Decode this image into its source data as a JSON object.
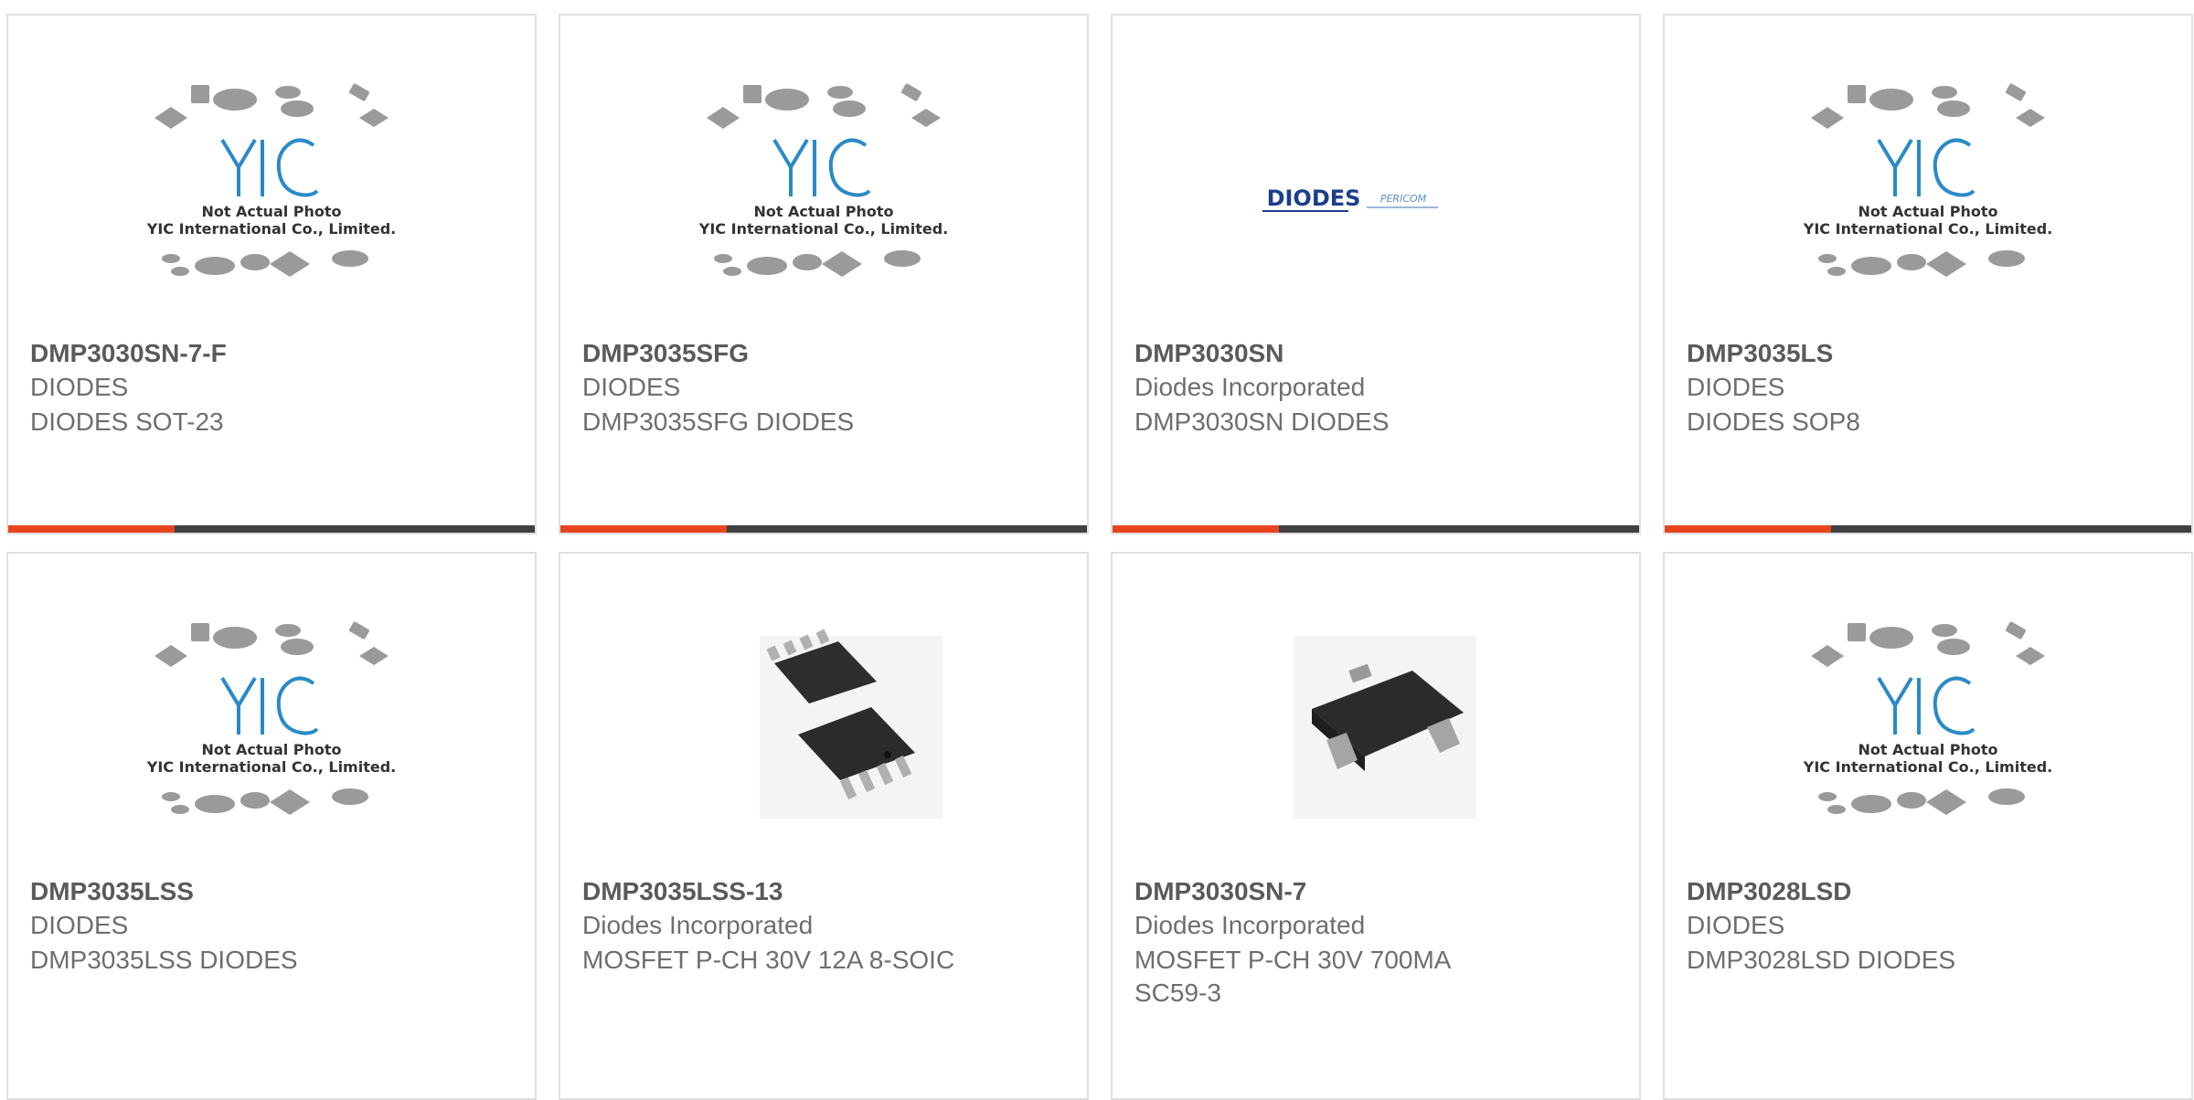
{
  "colors": {
    "accent": "#e8451f",
    "bar": "#404040",
    "title": "#5a5a5a",
    "text": "#6e6e6e",
    "yic_blue": "#2a8ac8"
  },
  "placeholder": {
    "line1": "Not Actual Photo",
    "line2": "YIC International Co., Limited.",
    "logo": "YIC"
  },
  "diodes_logo": {
    "brand": "DIODES",
    "sub": "PERICOM"
  },
  "products": [
    {
      "part": "DMP3030SN-7-F",
      "maker": "DIODES",
      "desc": "DIODES SOT-23",
      "image": "yic-placeholder"
    },
    {
      "part": "DMP3035SFG",
      "maker": "DIODES",
      "desc": "DMP3035SFG DIODES",
      "image": "yic-placeholder"
    },
    {
      "part": "DMP3030SN",
      "maker": "Diodes Incorporated",
      "desc": "DMP3030SN DIODES",
      "image": "diodes-logo"
    },
    {
      "part": "DMP3035LS",
      "maker": "DIODES",
      "desc": "DIODES SOP8",
      "image": "yic-placeholder"
    },
    {
      "part": "DMP3035LSS",
      "maker": "DIODES",
      "desc": "DMP3035LSS DIODES",
      "image": "yic-placeholder"
    },
    {
      "part": "DMP3035LSS-13",
      "maker": "Diodes Incorporated",
      "desc": "MOSFET P-CH 30V 12A 8-SOIC",
      "image": "soic8-chip"
    },
    {
      "part": "DMP3030SN-7",
      "maker": "Diodes Incorporated",
      "desc": "MOSFET P-CH 30V 700MA SC59-3",
      "image": "sot23-chip"
    },
    {
      "part": "DMP3028LSD",
      "maker": "DIODES",
      "desc": "DMP3028LSD DIODES",
      "image": "yic-placeholder"
    }
  ]
}
